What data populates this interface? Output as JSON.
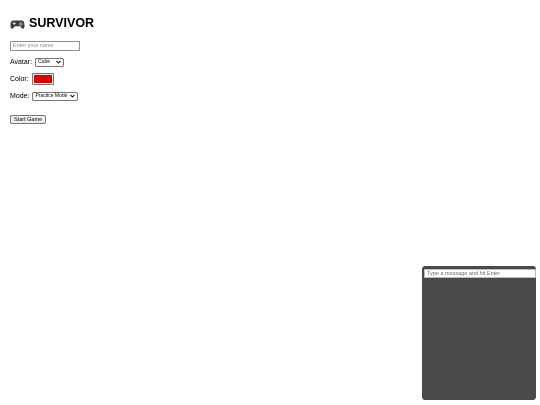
{
  "game": {
    "title": "SURVIVOR",
    "title_icon": "gamepad-icon"
  },
  "lobby": {
    "name_placeholder": "Enter your name",
    "name_value": "",
    "avatar_label": "Avatar:",
    "avatar_selected": "Cube",
    "color_label": "Color:",
    "color_value": "#e00000",
    "mode_label": "Mode:",
    "mode_selected": "Practice Mode",
    "start_label": "Start Game"
  },
  "chat": {
    "input_placeholder": "Type a message and hit Enter",
    "input_value": "",
    "background": "#4a4a4a"
  }
}
